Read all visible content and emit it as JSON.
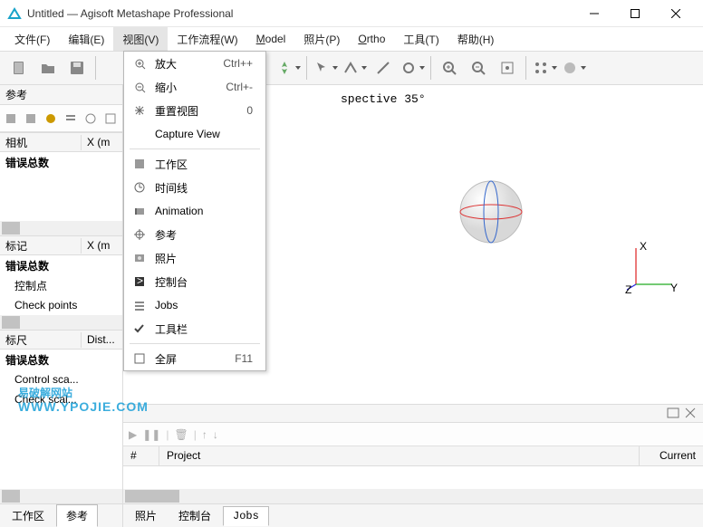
{
  "window": {
    "title": "Untitled — Agisoft Metashape Professional"
  },
  "menubar": {
    "items": [
      {
        "label": "文件(F)",
        "accel": "F"
      },
      {
        "label": "编辑(E)",
        "accel": "E"
      },
      {
        "label": "视图(V)",
        "accel": "V"
      },
      {
        "label": "工作流程(W)",
        "accel": "W"
      },
      {
        "label": "Model",
        "accel": "M"
      },
      {
        "label": "照片(P)",
        "accel": "P"
      },
      {
        "label": "Ortho",
        "accel": "O"
      },
      {
        "label": "工具(T)",
        "accel": "T"
      },
      {
        "label": "帮助(H)",
        "accel": "H"
      }
    ]
  },
  "view_menu": {
    "items": [
      {
        "icon": "zoom-in",
        "label": "放大",
        "accel": "Ctrl++"
      },
      {
        "icon": "zoom-out",
        "label": "缩小",
        "accel": "Ctrl+-"
      },
      {
        "icon": "reset-view",
        "label": "重置视图",
        "accel": "0"
      },
      {
        "icon": "",
        "label": "Capture View",
        "accel": ""
      },
      {
        "sep": true
      },
      {
        "icon": "workspace",
        "label": "工作区",
        "accel": ""
      },
      {
        "icon": "timeline",
        "label": "时间线",
        "accel": ""
      },
      {
        "icon": "animation",
        "label": "Animation",
        "accel": ""
      },
      {
        "icon": "reference",
        "label": "参考",
        "accel": ""
      },
      {
        "icon": "photos",
        "label": "照片",
        "accel": ""
      },
      {
        "icon": "console",
        "label": "控制台",
        "accel": ""
      },
      {
        "icon": "jobs",
        "label": "Jobs",
        "accel": ""
      },
      {
        "icon": "check",
        "label": "工具栏",
        "accel": ""
      },
      {
        "sep": true
      },
      {
        "icon": "fullscreen",
        "label": "全屏",
        "accel": "F11"
      }
    ]
  },
  "ref_panel": {
    "title": "参考",
    "cameras": {
      "header": "相机",
      "col2": "X (m",
      "row1": "错误总数"
    },
    "markers": {
      "header": "标记",
      "col2": "X (m",
      "row1": "错误总数",
      "row2": "控制点",
      "row3": "Check points"
    },
    "ruler": {
      "header": "标尺",
      "col2": "Dist...",
      "row1": "错误总数",
      "row2": "Control sca...",
      "row3": "Check scal..."
    }
  },
  "viewport": {
    "perspective": "spective 35°",
    "axis_x": "X",
    "axis_y": "Y",
    "axis_z": "Z"
  },
  "jobs": {
    "cols": {
      "num": "#",
      "project": "Project",
      "current": "Current"
    }
  },
  "tabs": {
    "left": {
      "workspace": "工作区",
      "reference": "参考"
    },
    "right": {
      "photos": "照片",
      "console": "控制台",
      "jobs": "Jobs"
    }
  },
  "watermark": {
    "line1": "易破解网站",
    "line2": "WWW.YPOJIE.COM"
  }
}
